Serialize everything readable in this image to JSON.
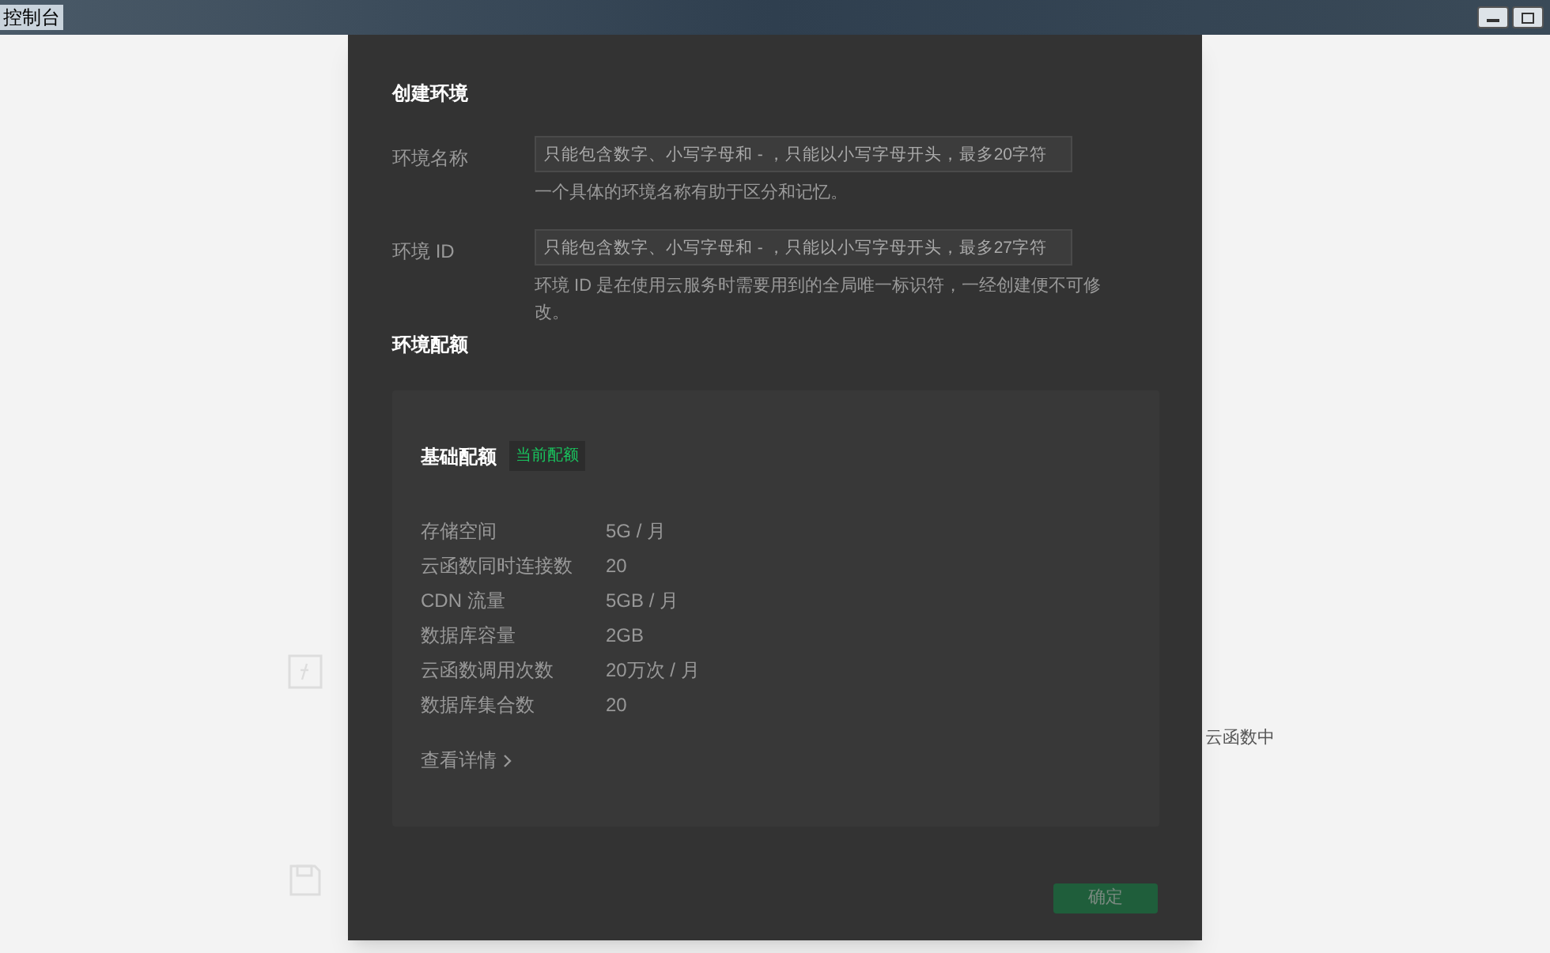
{
  "window": {
    "title": "控制台"
  },
  "background": {
    "side_text": "云函数中"
  },
  "dialog": {
    "title": "创建环境",
    "fields": [
      {
        "label": "环境名称",
        "placeholder": "只能包含数字、小写字母和 - ，只能以小写字母开头，最多20字符",
        "hint": "一个具体的环境名称有助于区分和记忆。"
      },
      {
        "label": "环境 ID",
        "placeholder": "只能包含数字、小写字母和 - ，只能以小写字母开头，最多27字符",
        "hint": "环境 ID 是在使用云服务时需要用到的全局唯一标识符，一经创建便不可修改。"
      }
    ],
    "quota_heading": "环境配额",
    "quota_card": {
      "title": "基础配额",
      "badge": "当前配额",
      "rows": [
        {
          "name": "存储空间",
          "value": "5G / 月"
        },
        {
          "name": "云函数同时连接数",
          "value": "20"
        },
        {
          "name": "CDN 流量",
          "value": "5GB / 月"
        },
        {
          "name": "数据库容量",
          "value": "2GB"
        },
        {
          "name": "云函数调用次数",
          "value": "20万次 / 月"
        },
        {
          "name": "数据库集合数",
          "value": "20"
        }
      ],
      "details_link": "查看详情"
    },
    "confirm_button": {
      "label": "确定",
      "disabled": true
    }
  }
}
